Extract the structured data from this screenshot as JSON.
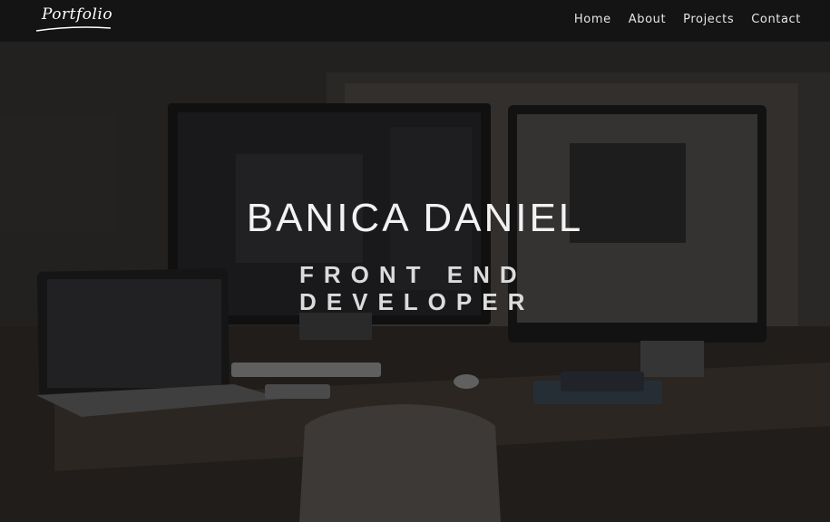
{
  "brand": {
    "logo_text": "Portfolio"
  },
  "nav": {
    "items": [
      {
        "label": "Home"
      },
      {
        "label": "About"
      },
      {
        "label": "Projects"
      },
      {
        "label": "Contact"
      }
    ]
  },
  "hero": {
    "title": "BANICA DANIEL",
    "subtitle": "FRONT END DEVELOPER"
  }
}
